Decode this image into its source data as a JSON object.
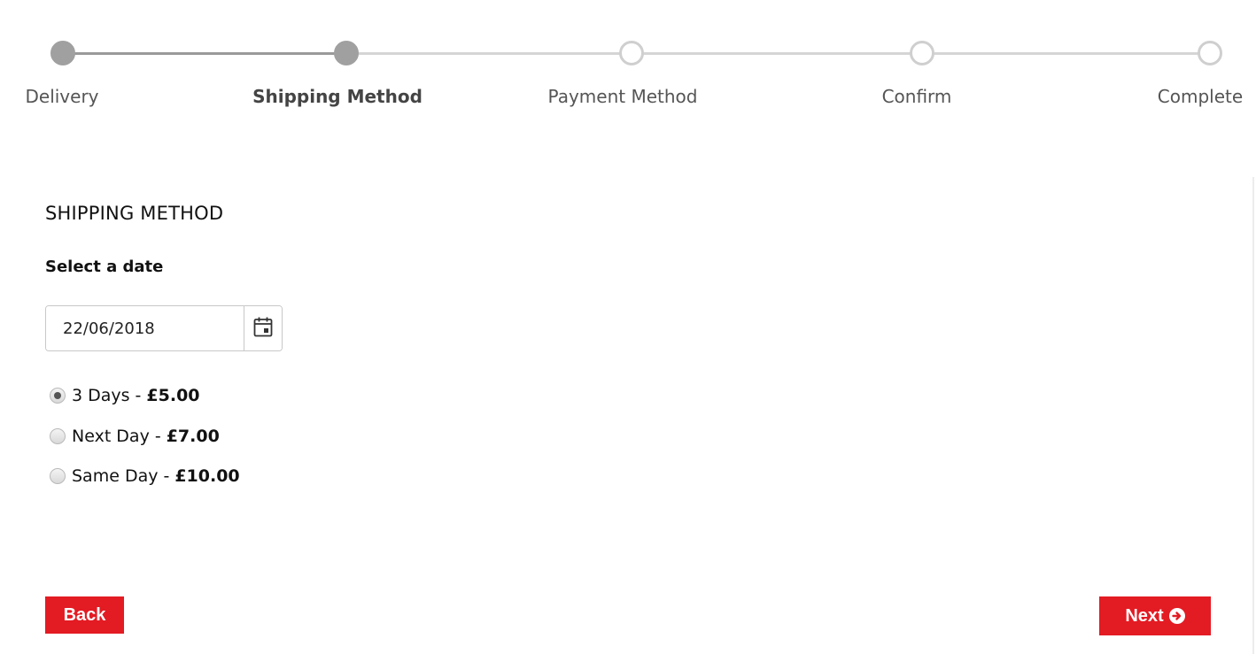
{
  "progress": {
    "steps": [
      {
        "label": "Delivery",
        "state": "done"
      },
      {
        "label": "Shipping Method",
        "state": "current"
      },
      {
        "label": "Payment Method",
        "state": "todo"
      },
      {
        "label": "Confirm",
        "state": "todo"
      },
      {
        "label": "Complete",
        "state": "todo"
      }
    ]
  },
  "shipping": {
    "title": "SHIPPING METHOD",
    "date_label": "Select a date",
    "date_value": "22/06/2018",
    "calendar_icon": "calendar-icon",
    "options": [
      {
        "name": "3 Days",
        "separator": "-",
        "price": "£5.00",
        "selected": true
      },
      {
        "name": "Next Day",
        "separator": "-",
        "price": "£7.00",
        "selected": false
      },
      {
        "name": "Same Day",
        "separator": "-",
        "price": "£10.00",
        "selected": false
      }
    ]
  },
  "actions": {
    "back_label": "Back",
    "next_label": "Next",
    "next_icon": "arrow-circle-right-icon"
  },
  "colors": {
    "accent": "#e31b23",
    "step_done": "#a0a0a0",
    "step_todo": "#cfcfcf"
  }
}
